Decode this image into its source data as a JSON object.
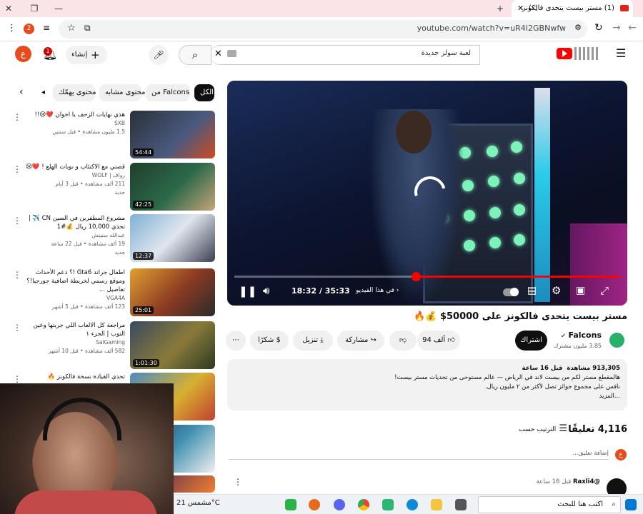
{
  "browser": {
    "tab_title": "(1) مستر بيست يتحدى فالكونز",
    "url": "youtube.com/watch?v=uR4I2GBNwfw",
    "notif_count": "2"
  },
  "header": {
    "search_text": "لعبة سولز جديدة",
    "create_label": "إنشاء",
    "notifications_badge": "1",
    "avatar_letter": "ع"
  },
  "chips": [
    "الكل",
    "من Falcons",
    "محتوى مشابه",
    "محتوى يهمّك"
  ],
  "player": {
    "time": "18:32 / 35:33",
    "chapter": "في هذا الفيديو",
    "progress": 0.53
  },
  "video": {
    "title": "مستر بيست يتحدى فالكونز على 50000$ 💰🔥",
    "channel": "Falcons",
    "subscribers": "3.85 مليون مشترك",
    "subscribe_label": "اشتراك",
    "likes": "94 ألف",
    "share_label": "مشاركة",
    "download_label": "تنزيل",
    "thanks_label": "شكرًا",
    "views": "913,305 مشاهدة",
    "date": "قبل 16 ساعة",
    "desc_line1": "هالمقطع مستر لكم من بيست لاند  في الرياض — عالم مستوحى من تحديات مستر بيست!",
    "desc_line2": "نافس على مجموع جوائز تصل لأكثر من ٢ مليون ريال.",
    "desc_more": "...المزيد"
  },
  "comments": {
    "count": "4,116 تعليقًا",
    "sort_label": "الترتيب حسب",
    "add_placeholder": "إضافة تعليق...",
    "first_author": "@Raxli4",
    "first_time": "قبل 16 ساعة"
  },
  "recommendations": [
    {
      "title": "هذي نهايات الزحف يا اخوان ❤️😢!!",
      "channel": "SXB",
      "meta": "1.5 مليون مشاهدة • قبل سنتين",
      "duration": "54:44"
    },
    {
      "title": "قصتي مع الاكتئاب و نوبات الهلع ! ❤️😢",
      "channel": "رواف | WOLF",
      "meta": "211 ألف مشاهدة • قبل 3 أيام",
      "badge": "جديد",
      "duration": "42:25"
    },
    {
      "title": "مشروع المطفرين في الصين CN ✈️ | تحدي 10,000 ريال 💰#1",
      "channel": "عبدالله سنيتش",
      "meta": "19 ألف مشاهدة • قبل 22 ساعة",
      "badge": "جديد",
      "duration": "12:37"
    },
    {
      "title": "اطفال جراند Gta6 !؟ دعم الأحداث وموقع رسمي لخريطة اضافية جورجيا!؟ تفاصيل ...",
      "channel": "VGA4A",
      "meta": "123 ألف مشاهدة • قبل 5 أشهر",
      "duration": "25:01"
    },
    {
      "title": "مراجعة كل الالعاب اللي جربتها وعين التوب | الجزء ١",
      "channel": "SalGaming",
      "meta": "582 ألف مشاهدة • قبل 10 أشهر",
      "duration": "1:01:30"
    },
    {
      "title": "تحدي القيادة نسخة فالكونز 🔥",
      "channel": "",
      "meta": "",
      "duration": ""
    }
  ],
  "taskbar": {
    "search": "اكتب هنا للبحث",
    "weather": "مشمس 21°C"
  },
  "colors": {
    "brand_red": "#ff0000",
    "avatar_orange": "#e8491d"
  }
}
